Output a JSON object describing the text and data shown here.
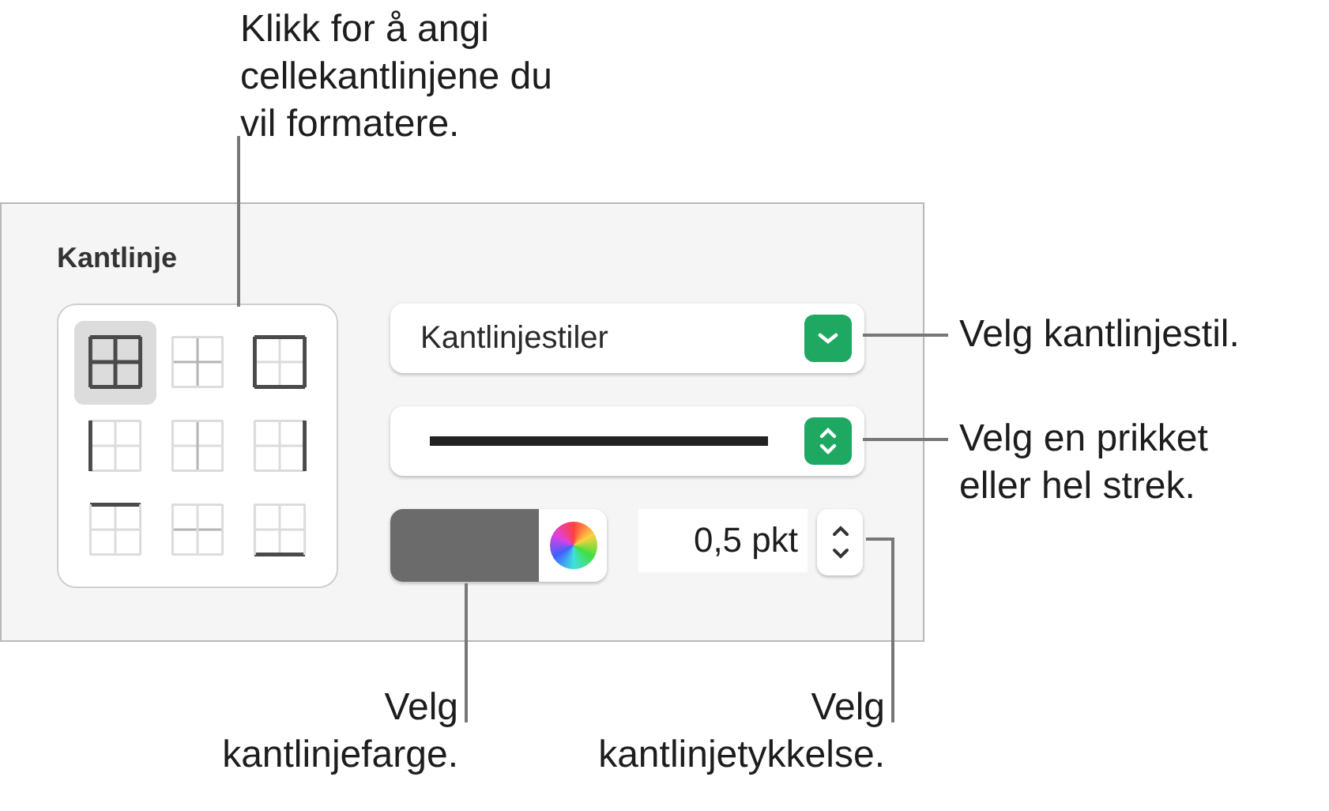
{
  "callouts": [
    {
      "text": "Klikk for å angi cellekantlinjene du vil formatere."
    },
    {
      "text": "Velg kantlinjestil."
    },
    {
      "text": "Velg en prikket eller hel strek."
    },
    {
      "text": "Velg kantlinjefarge."
    },
    {
      "text": "Velg kantlinjetykkelse."
    }
  ],
  "panel": {
    "title": "Kantlinje",
    "border_buttons": [
      {
        "kind": "all",
        "selected": true
      },
      {
        "kind": "inner",
        "selected": false
      },
      {
        "kind": "outer",
        "selected": false
      },
      {
        "kind": "left",
        "selected": false
      },
      {
        "kind": "inner-vertical",
        "selected": false
      },
      {
        "kind": "right",
        "selected": false
      },
      {
        "kind": "top",
        "selected": false
      },
      {
        "kind": "inner-horizontal",
        "selected": false
      },
      {
        "kind": "bottom",
        "selected": false
      }
    ],
    "style_popup": {
      "label": "Kantlinjestiler"
    },
    "thickness": {
      "value": "0,5 pkt"
    }
  }
}
